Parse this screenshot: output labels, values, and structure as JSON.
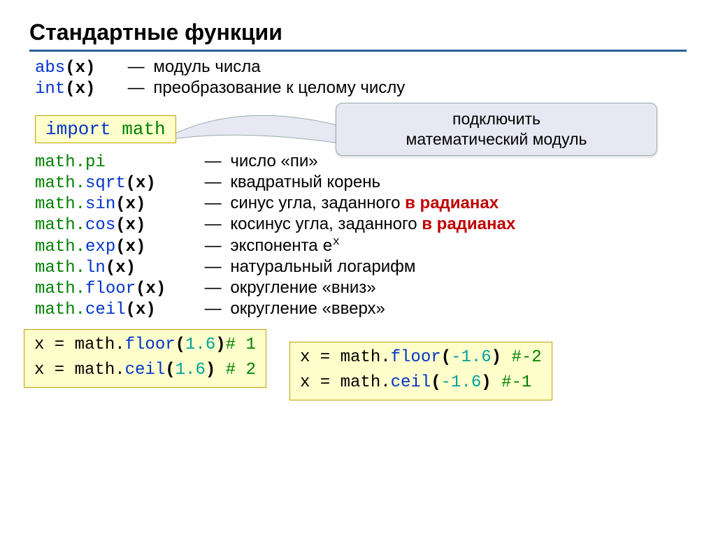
{
  "title": "Стандартные функции",
  "builtins": [
    {
      "kw": "abs",
      "args": "(x)",
      "desc": "модуль числа"
    },
    {
      "kw": "int",
      "args": "(x)",
      "desc": "преобразование к целому числу"
    }
  ],
  "import_kw": "import",
  "import_name": "math",
  "callout_l1": "подключить",
  "callout_l2": "математический модуль",
  "math_fns": {
    "pi": {
      "code": "math.pi",
      "dash": "—",
      "desc": "число «пи»"
    },
    "sqrt": {
      "code_pre": "math.",
      "fn": "sqrt",
      "args": "(x)",
      "dash": "—",
      "desc": "квадратный корень"
    },
    "sin": {
      "code_pre": "math.",
      "fn": "sin",
      "args": "(x)",
      "dash": "—",
      "desc_pre": "синус угла, заданного ",
      "desc_red": "в радианах"
    },
    "cos": {
      "code_pre": "math.",
      "fn": "cos",
      "args": "(x)",
      "dash": "—",
      "desc_pre": "косинус угла, заданного ",
      "desc_red": "в радианах"
    },
    "exp": {
      "code_pre": "math.",
      "fn": "exp",
      "args": "(x)",
      "dash": "—",
      "desc": "экспонента ",
      "tail_mono": "e",
      "tail_sup": "x"
    },
    "ln": {
      "code_pre": "math.",
      "fn": "ln",
      "args": "(x)",
      "dash": "—",
      "desc": "натуральный логарифм"
    },
    "floor": {
      "code_pre": "math.",
      "fn": "floor",
      "args": "(x)",
      "dash": "—",
      "desc": "округление «вниз»"
    },
    "ceil": {
      "code_pre": "math.",
      "fn": "ceil",
      "args": "(x)",
      "dash": "—",
      "desc": "округление «вверх»"
    }
  },
  "ex_left": {
    "l1_pre": "x = math.",
    "l1_fn": "floor",
    "l1_args_open": "(",
    "l1_num": "1.6",
    "l1_args_close": ")",
    "l1_cmt": "# 1",
    "l2_pre": "x = math.",
    "l2_fn": "ceil",
    "l2_args_open": "(",
    "l2_num": "1.6",
    "l2_args_close": ") ",
    "l2_cmt": "# 2"
  },
  "ex_right": {
    "l1_pre": "x = math.",
    "l1_fn": "floor",
    "l1_args_open": "(",
    "l1_num": "-1.6",
    "l1_args_close": ") ",
    "l1_cmt": "#-2",
    "l2_pre": "x = math.",
    "l2_fn": "ceil",
    "l2_args_open": "(",
    "l2_num": "-1.6",
    "l2_args_close": ")  ",
    "l2_cmt": "#-1"
  }
}
